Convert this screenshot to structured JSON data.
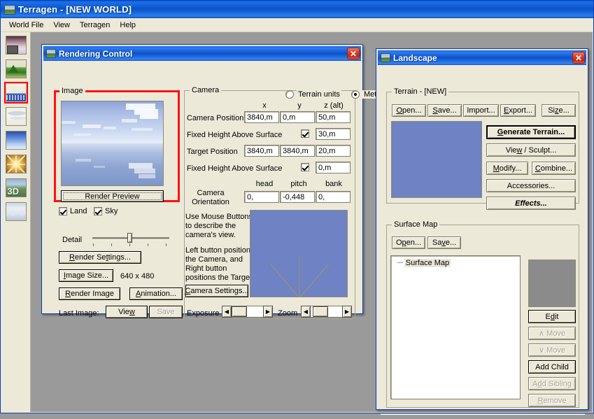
{
  "app": {
    "title": "Terragen  -  [NEW WORLD]",
    "menu": [
      "World File",
      "View",
      "Terragen",
      "Help"
    ]
  },
  "toolbar": {
    "items": [
      {
        "name": "render-view-icon",
        "label": "Render"
      },
      {
        "name": "terrain-icon",
        "label": "Terrain"
      },
      {
        "name": "water-icon",
        "label": "Water",
        "selected": true
      },
      {
        "name": "atmosphere-icon",
        "label": "Atmosphere"
      },
      {
        "name": "sky-icon",
        "label": "Sky"
      },
      {
        "name": "sun-lighting-icon",
        "label": "Lighting"
      },
      {
        "name": "three-d-preview-icon",
        "label": "3D Preview"
      },
      {
        "name": "image-icon",
        "label": "Image"
      }
    ]
  },
  "rendering_control": {
    "title": "Rendering Control",
    "close_label": "✕",
    "image_group": {
      "title": "Image",
      "render_preview_button": "Render Preview",
      "land_checkbox": {
        "label": "Land",
        "checked": true
      },
      "sky_checkbox": {
        "label": "Sky",
        "checked": true
      },
      "detail_label": "Detail",
      "detail_value": 50,
      "render_settings_button": "Render Settings...",
      "image_size_button": "Image Size...",
      "image_size_value": "640 x 480",
      "render_image_button": "Render Image",
      "animation_button": "Animation...",
      "last_image_label": "Last Image:",
      "view_button": "View",
      "save_button": "Save",
      "save_disabled": true
    },
    "camera_group": {
      "title": "Camera",
      "units": {
        "terrain_units": {
          "label": "Terrain units",
          "selected": false
        },
        "metres": {
          "label": "Metres",
          "selected": true
        }
      },
      "col_x": "x",
      "col_y": "y",
      "col_z": "z (alt)",
      "camera_position_label": "Camera Position",
      "camera_position": {
        "x": "3840,m",
        "y": "0,m",
        "z": "50,m"
      },
      "fixed_height_1_label": "Fixed Height Above Surface",
      "fixed_height_1_checked": true,
      "fixed_height_1_value": "30,m",
      "target_position_label": "Target Position",
      "target_position": {
        "x": "3840,m",
        "y": "3840,m",
        "z": "20,m"
      },
      "fixed_height_2_label": "Fixed Height Above Surface",
      "fixed_height_2_checked": true,
      "fixed_height_2_value": "0,m",
      "orientation_label_line1": "Camera",
      "orientation_label_line2": "Orientation",
      "col_head": "head",
      "col_pitch": "pitch",
      "col_bank": "bank",
      "orientation": {
        "head": "0,",
        "pitch": "-0,448",
        "bank": "0,"
      },
      "hint_line1": "Use Mouse Buttons",
      "hint_line2": "to describe the",
      "hint_line3": "camera's view.",
      "hint_line4": "Left button positions",
      "hint_line5": "the Camera, and",
      "hint_line6": "Right button",
      "hint_line7": "positions the Target.",
      "camera_settings_button": "Camera Settings...",
      "exposure_label": "Exposure",
      "zoom_label": "Zoom"
    }
  },
  "landscape": {
    "title": "Landscape",
    "close_label": "✕",
    "terrain_group": {
      "title": "Terrain - [NEW]",
      "open_button": "Open...",
      "save_button": "Save...",
      "import_button": "Import...",
      "export_button": "Export...",
      "size_button": "Size...",
      "generate_terrain_button": "Generate Terrain...",
      "view_sculpt_button": "View / Sculpt...",
      "modify_button": "Modify...",
      "combine_button": "Combine...",
      "accessories_button": "Accessories...",
      "effects_button": "Effects..."
    },
    "surface_map_group": {
      "title": "Surface Map",
      "open_button": "Open...",
      "save_button": "Save...",
      "tree_root": "Surface Map",
      "edit_button": "Edit",
      "move_up_button": "∧ Move",
      "move_down_button": "∨ Move",
      "add_child_button": "Add Child",
      "add_sibling_button": "Add Sibling",
      "remove_button": "Remove",
      "disabled": [
        "move_up_button",
        "move_down_button",
        "add_sibling_button",
        "remove_button"
      ]
    }
  },
  "colors": {
    "titlebar_blue": "#0a52c8",
    "dialog_face": "#ece9d8",
    "highlight_red": "#ff1111",
    "preview_blue": "#6e82c4",
    "gray_pane": "#8b8b8b"
  }
}
